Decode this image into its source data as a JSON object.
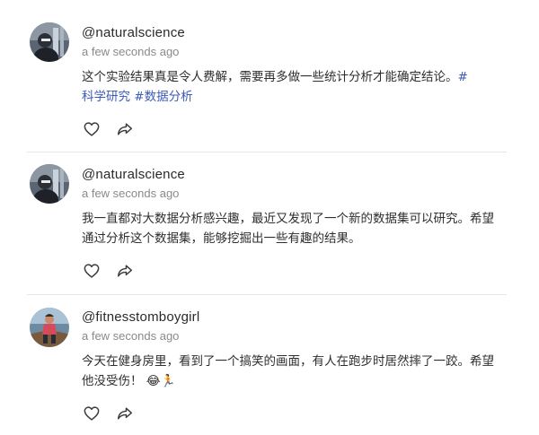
{
  "posts": [
    {
      "username": "@naturalscience",
      "timestamp": "a few seconds ago",
      "text": "这个实验结果真是令人费解，需要再多做一些统计分析才能确定结论。",
      "hashtags": [
        "#",
        "科学研究",
        "#数据分析"
      ],
      "icons": {
        "like": "heart-icon",
        "share": "share-arrow-icon"
      }
    },
    {
      "username": "@naturalscience",
      "timestamp": "a few seconds ago",
      "text": "我一直都对大数据分析感兴趣，最近又发现了一个新的数据集可以研究。希望通过分析这个数据集，能够挖掘出一些有趣的结果。",
      "icons": {
        "like": "heart-icon",
        "share": "share-arrow-icon"
      }
    },
    {
      "username": "@fitnesstomboygirl",
      "timestamp": "a few seconds ago",
      "text": "今天在健身房里，看到了一个搞笑的画面，有人在跑步时居然摔了一跤。希望他没受伤！",
      "emoji": "😂🏃",
      "icons": {
        "like": "heart-icon",
        "share": "share-arrow-icon"
      }
    }
  ],
  "colors": {
    "hashtag": "#3c5bb5",
    "username": "#2a2a2a",
    "timestamp": "#8a8a8a",
    "divider": "#e6e6e6"
  }
}
